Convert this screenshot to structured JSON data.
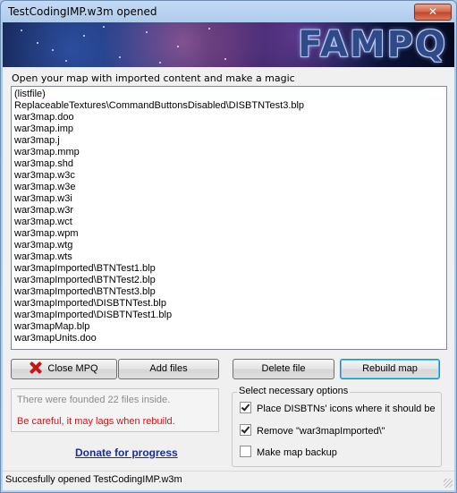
{
  "window": {
    "title": "TestCodingIMP.w3m opened",
    "close_glyph": "✕"
  },
  "banner": {
    "logo_text": "FAMPQ"
  },
  "hint": "Open your map with imported content and make a magic",
  "files": [
    "(listfile)",
    "ReplaceableTextures\\CommandButtonsDisabled\\DISBTNTest3.blp",
    "war3map.doo",
    "war3map.imp",
    "war3map.j",
    "war3map.mmp",
    "war3map.shd",
    "war3map.w3c",
    "war3map.w3e",
    "war3map.w3i",
    "war3map.w3r",
    "war3map.wct",
    "war3map.wpm",
    "war3map.wtg",
    "war3map.wts",
    "war3mapImported\\BTNTest1.blp",
    "war3mapImported\\BTNTest2.blp",
    "war3mapImported\\BTNTest3.blp",
    "war3mapImported\\DISBTNTest.blp",
    "war3mapImported\\DISBTNTest1.blp",
    "war3mapMap.blp",
    "war3mapUnits.doo"
  ],
  "buttons": {
    "close_mpq": "Close MPQ",
    "add_files": "Add files",
    "delete_file": "Delete file",
    "rebuild_map": "Rebuild map"
  },
  "info": {
    "count_text": "There were founded 22 files inside.",
    "warning_text": "Be careful, it may lags when rebuild."
  },
  "donate_link": "Donate for progress",
  "options": {
    "legend": "Select necessary options",
    "items": [
      {
        "label": "Place DISBTNs' icons where it should be",
        "checked": true
      },
      {
        "label": "Remove \"war3mapImported\\\"",
        "checked": true
      },
      {
        "label": "Make map backup",
        "checked": false
      }
    ]
  },
  "status": "Succesfully opened TestCodingIMP.w3m",
  "colors": {
    "warning": "#d21414",
    "link": "#1a2e9c",
    "close_icon": "#c21818"
  }
}
